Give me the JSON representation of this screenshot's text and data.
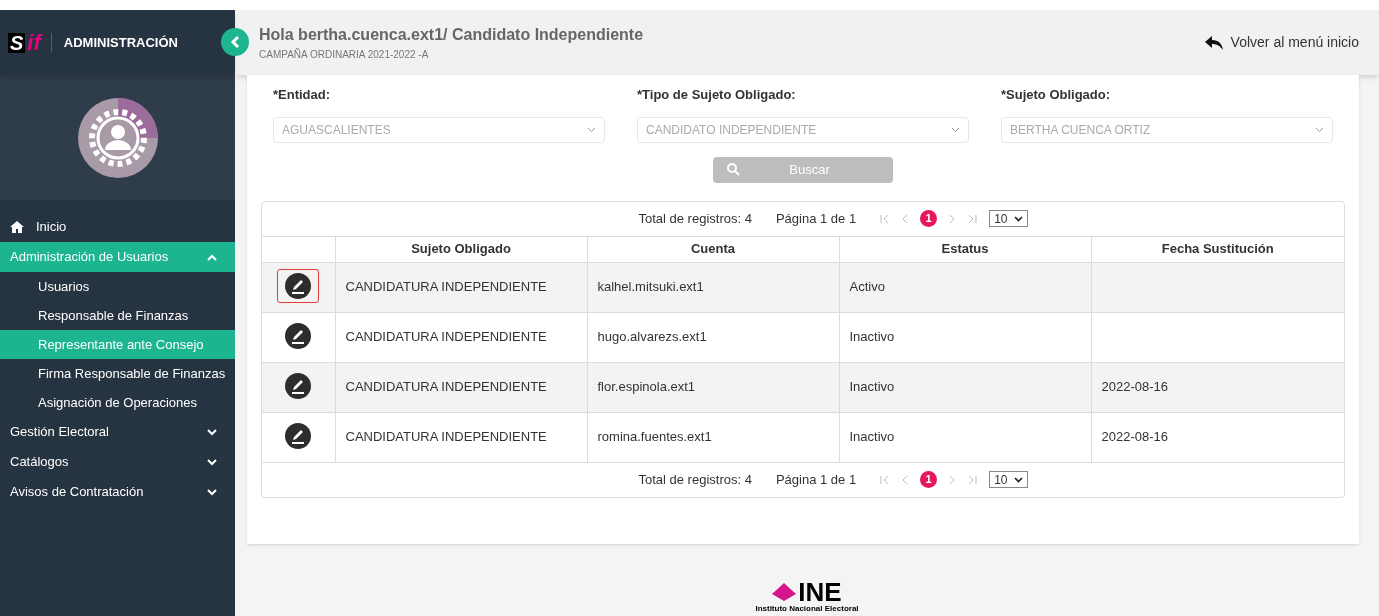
{
  "sidebar": {
    "logo": {
      "mark_left": "S",
      "mark_right": "if",
      "title": "ADMINISTRACIÓN"
    },
    "items": [
      {
        "label": "Inicio",
        "kind": "home",
        "selected": false
      },
      {
        "label": "Administración de Usuarios",
        "kind": "group",
        "selected": true,
        "expanded": true,
        "children": [
          {
            "label": "Usuarios",
            "selected": false
          },
          {
            "label": "Responsable de Finanzas",
            "selected": false
          },
          {
            "label": "Representante ante Consejo",
            "selected": true
          },
          {
            "label": "Firma Responsable de Finanzas",
            "selected": false
          },
          {
            "label": "Asignación de Operaciones",
            "selected": false
          }
        ]
      },
      {
        "label": "Gestión Electoral",
        "kind": "group",
        "selected": false,
        "expanded": false
      },
      {
        "label": "Catálogos",
        "kind": "group",
        "selected": false,
        "expanded": false
      },
      {
        "label": "Avisos de Contratación",
        "kind": "group",
        "selected": false,
        "expanded": false
      }
    ]
  },
  "header": {
    "title": "Hola bertha.cuenca.ext1/ Candidato Independiente",
    "subtitle": "CAMPAÑA ORDINARIA 2021-2022 -A",
    "back_link": "Volver al menú inicio"
  },
  "filters": [
    {
      "label": "*Entidad:",
      "value": "AGUASCALIENTES"
    },
    {
      "label": "*Tipo de Sujeto Obligado:",
      "value": "CANDIDATO INDEPENDIENTE"
    },
    {
      "label": "*Sujeto Obligado:",
      "value": "BERTHA CUENCA ORTIZ"
    }
  ],
  "search_button": "Buscar",
  "pagination_top": {
    "total": "Total de registros: 4",
    "page": "Página 1 de 1",
    "current": "1",
    "per_page": "10"
  },
  "table": {
    "columns": [
      "Sujeto Obligado",
      "Cuenta",
      "Estatus",
      "Fecha Sustitución"
    ],
    "rows": [
      {
        "selected": true,
        "cells": [
          "CANDIDATURA INDEPENDIENTE",
          "kalhel.mitsuki.ext1",
          "Activo",
          ""
        ]
      },
      {
        "selected": false,
        "cells": [
          "CANDIDATURA INDEPENDIENTE",
          "hugo.alvarezs.ext1",
          "Inactivo",
          ""
        ]
      },
      {
        "selected": false,
        "cells": [
          "CANDIDATURA INDEPENDIENTE",
          "flor.espinola.ext1",
          "Inactivo",
          "2022-08-16"
        ]
      },
      {
        "selected": false,
        "cells": [
          "CANDIDATURA INDEPENDIENTE",
          "romina.fuentes.ext1",
          "Inactivo",
          "2022-08-16"
        ]
      }
    ]
  },
  "pagination_bottom": {
    "total": "Total de registros: 4",
    "page": "Página 1 de 1",
    "current": "1",
    "per_page": "10"
  },
  "footer": {
    "logo_text": "INE",
    "logo_caption": "Instituto Nacional Electoral"
  }
}
